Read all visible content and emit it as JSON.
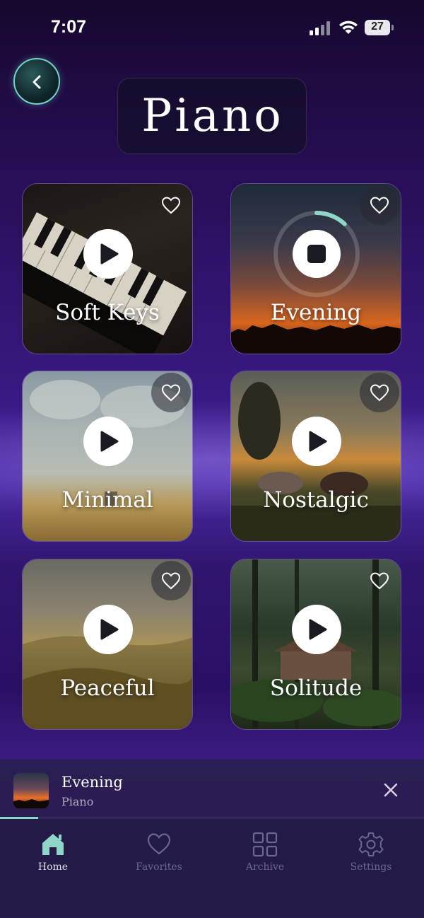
{
  "status": {
    "time": "7:07",
    "battery": "27"
  },
  "header": {
    "title": "Piano"
  },
  "tracks": [
    {
      "title": "Soft Keys",
      "state": "paused",
      "favorite": false
    },
    {
      "title": "Evening",
      "state": "playing",
      "favorite": false,
      "progress": 0.12
    },
    {
      "title": "Minimal",
      "state": "paused",
      "favorite": false
    },
    {
      "title": "Nostalgic",
      "state": "paused",
      "favorite": false
    },
    {
      "title": "Peaceful",
      "state": "paused",
      "favorite": false
    },
    {
      "title": "Solitude",
      "state": "paused",
      "favorite": false
    }
  ],
  "now_playing": {
    "title": "Evening",
    "subtitle": "Piano",
    "progress": 0.09
  },
  "tabs": [
    {
      "label": "Home",
      "icon": "home-icon",
      "active": true
    },
    {
      "label": "Favorites",
      "icon": "heart-icon",
      "active": false
    },
    {
      "label": "Archive",
      "icon": "grid-icon",
      "active": false
    },
    {
      "label": "Settings",
      "icon": "gear-icon",
      "active": false
    }
  ],
  "colors": {
    "accent": "#8fd6c8",
    "inactive_tab": "#6b6690"
  }
}
